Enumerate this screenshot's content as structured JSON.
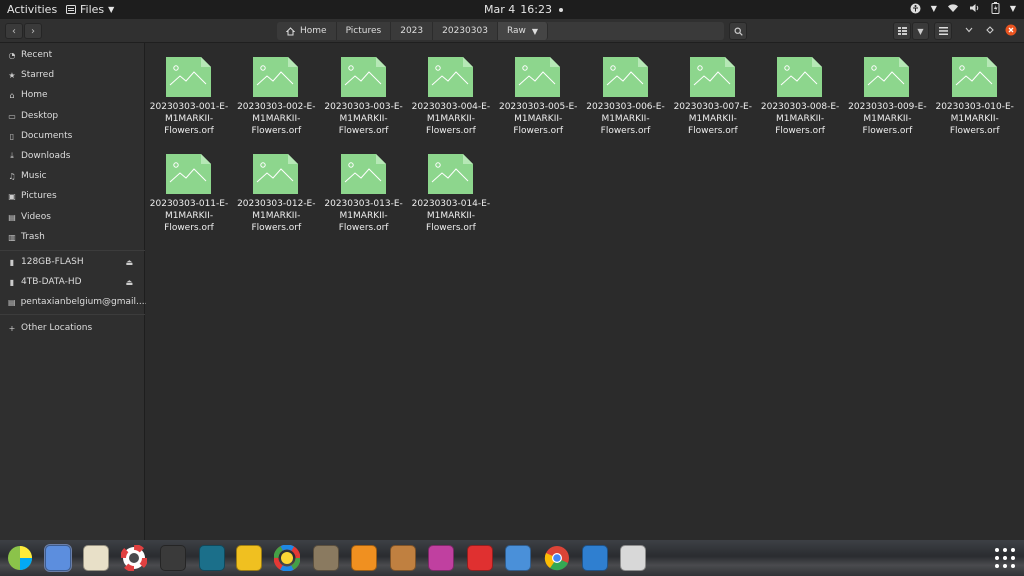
{
  "topbar": {
    "activities": "Activities",
    "app_name": "Files",
    "date": "Mar 4",
    "time": "16:23"
  },
  "breadcrumb": [
    "Home",
    "Pictures",
    "2023",
    "20230303",
    "Raw"
  ],
  "sidebar": {
    "places": [
      {
        "label": "Recent",
        "icon": "clock-icon"
      },
      {
        "label": "Starred",
        "icon": "star-icon"
      },
      {
        "label": "Home",
        "icon": "home-icon"
      },
      {
        "label": "Desktop",
        "icon": "desktop-icon"
      },
      {
        "label": "Documents",
        "icon": "document-icon"
      },
      {
        "label": "Downloads",
        "icon": "download-icon"
      },
      {
        "label": "Music",
        "icon": "music-icon"
      },
      {
        "label": "Pictures",
        "icon": "picture-icon"
      },
      {
        "label": "Videos",
        "icon": "video-icon"
      },
      {
        "label": "Trash",
        "icon": "trash-icon"
      }
    ],
    "devices": [
      {
        "label": "128GB-FLASH",
        "icon": "usb-drive-icon"
      },
      {
        "label": "4TB-DATA-HD",
        "icon": "hard-drive-icon"
      },
      {
        "label": "pentaxianbelgium@gmail....",
        "icon": "online-account-icon"
      }
    ],
    "other": {
      "label": "Other Locations",
      "icon": "plus-icon"
    }
  },
  "files": [
    "20230303-001-E-\nM1MARKII-\nFlowers.orf",
    "20230303-002-E-\nM1MARKII-\nFlowers.orf",
    "20230303-003-E-\nM1MARKII-\nFlowers.orf",
    "20230303-004-E-\nM1MARKII-\nFlowers.orf",
    "20230303-005-E-\nM1MARKII-\nFlowers.orf",
    "20230303-006-E-\nM1MARKII-\nFlowers.orf",
    "20230303-007-E-\nM1MARKII-\nFlowers.orf",
    "20230303-008-E-\nM1MARKII-\nFlowers.orf",
    "20230303-009-E-\nM1MARKII-\nFlowers.orf",
    "20230303-010-E-\nM1MARKII-\nFlowers.orf",
    "20230303-011-E-\nM1MARKII-\nFlowers.orf",
    "20230303-012-E-\nM1MARKII-\nFlowers.orf",
    "20230303-013-E-\nM1MARKII-\nFlowers.orf",
    "20230303-014-E-\nM1MARKII-\nFlowers.orf"
  ],
  "colors": {
    "file_icon_green": "#8dd68d",
    "file_icon_fold": "#b6e8b6",
    "topbar_bg": "#1d1d1d",
    "sidebar_bg": "#2f2f2f",
    "main_bg": "#2b2b2b"
  },
  "dock": [
    {
      "name": "disk-usage-icon",
      "color": "#4caf50"
    },
    {
      "name": "files-app-icon",
      "color": "#5c8ede"
    },
    {
      "name": "rhythmbox-icon",
      "color": "#e8e0c8"
    },
    {
      "name": "help-lifebuoy-icon",
      "color": "#e04040"
    },
    {
      "name": "screen-capture-icon",
      "color": "#3a3a3a"
    },
    {
      "name": "book-reader-icon",
      "color": "#1b6f8a"
    },
    {
      "name": "linux-app-icon",
      "color": "#f0c020"
    },
    {
      "name": "color-wheel-icon",
      "color": "#d040c0"
    },
    {
      "name": "gimp-icon",
      "color": "#8a7a60"
    },
    {
      "name": "disc-burner-icon",
      "color": "#f09020"
    },
    {
      "name": "photo-gallery-icon",
      "color": "#c08040"
    },
    {
      "name": "screenshot-tool-icon",
      "color": "#c040a0"
    },
    {
      "name": "sd-card-icon",
      "color": "#e03030"
    },
    {
      "name": "mail-client-icon",
      "color": "#4a90d9"
    },
    {
      "name": "chrome-browser-icon",
      "color": "#34a853"
    },
    {
      "name": "usb-writer-icon",
      "color": "#2f7fd0"
    },
    {
      "name": "display-settings-icon",
      "color": "#d8d8d8"
    },
    {
      "name": "app-grid-icon",
      "color": "#ffffff"
    }
  ]
}
